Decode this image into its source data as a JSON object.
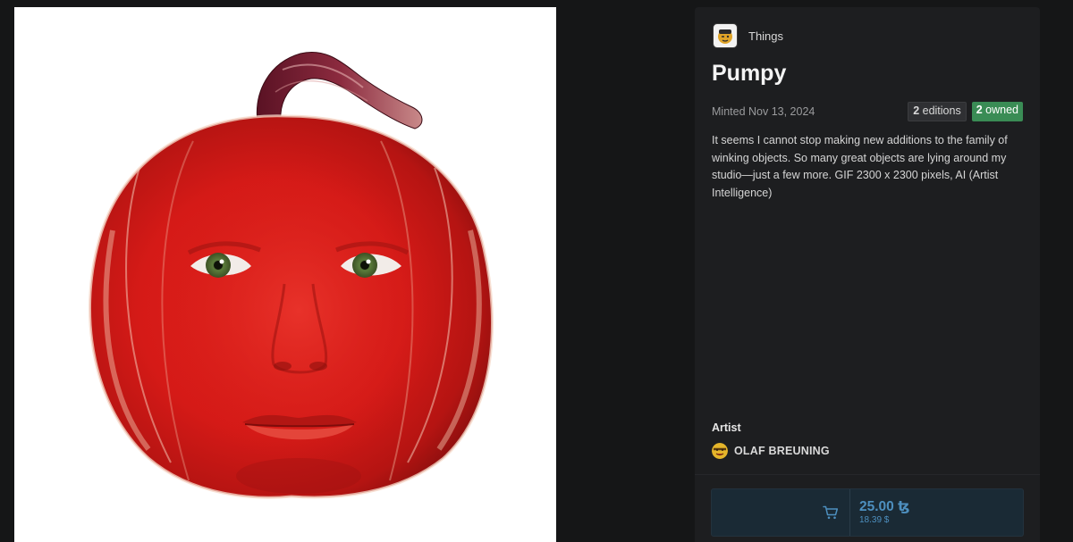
{
  "collection": {
    "name": "Things",
    "avatar_icon": "winking-face-avatar-icon"
  },
  "token": {
    "title": "Pumpy",
    "minted": "Minted Nov 13, 2024",
    "editions_count": "2",
    "editions_label": "editions",
    "owned_count": "2",
    "owned_label": "owned",
    "description": "It seems I cannot stop making new additions to the family of winking objects. So many great objects are lying around my studio—just a few more. GIF 2300 x 2300 pixels, AI (Artist Intelligence)"
  },
  "artist": {
    "heading": "Artist",
    "name": "OLAF BREUNING",
    "avatar_icon": "emoji-face-avatar-icon"
  },
  "purchase": {
    "price": "25.00 ꜩ",
    "price_usd": "18.39 $",
    "cart_icon": "cart-icon"
  },
  "colors": {
    "background": "#151617",
    "panel": "#1d1e20",
    "owned_badge": "#3a8c55",
    "buy_accent": "#4d8fbf",
    "buy_box": "#1a2a35"
  }
}
